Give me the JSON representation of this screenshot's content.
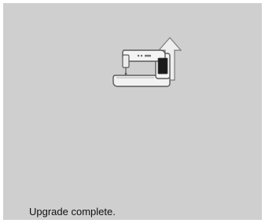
{
  "screen": {
    "background_color": "#cfcfcf",
    "icon": "sewing-machine-upgrade-icon",
    "status_text": "Upgrade complete."
  },
  "colors": {
    "machine_body": "#f2f2f2",
    "machine_outline": "#5a5a5a",
    "arrow": "#eeeeee",
    "display_panel": "#1a1a1a"
  }
}
